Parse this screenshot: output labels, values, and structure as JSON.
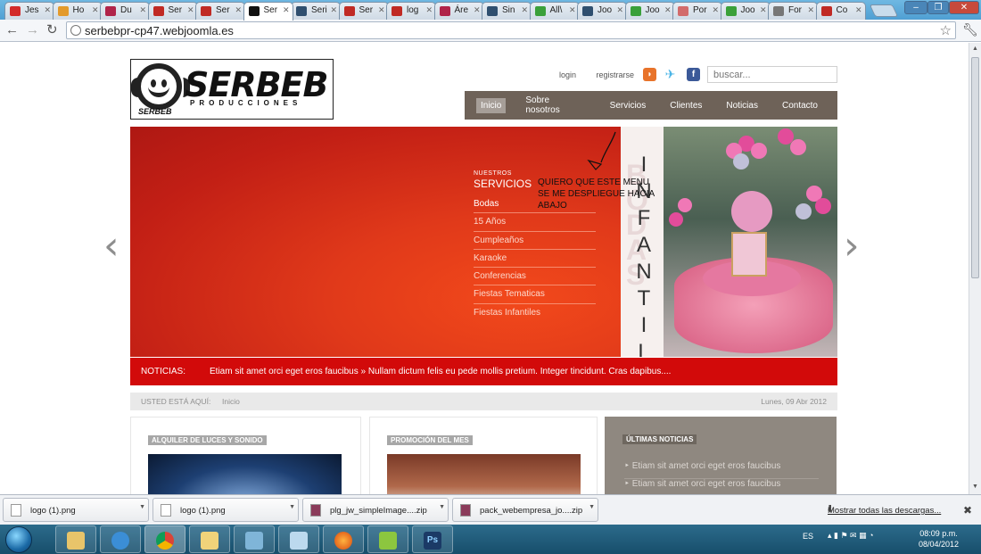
{
  "browser": {
    "tabs": [
      {
        "label": "Jes",
        "favicon": "youtube-icon",
        "color": "#d32b2b"
      },
      {
        "label": "Ho",
        "favicon": "hotmail-icon",
        "color": "#e39a2c"
      },
      {
        "label": "Du",
        "favicon": "forum-icon",
        "color": "#b0244a"
      },
      {
        "label": "Ser",
        "favicon": "site-icon",
        "color": "#c02a24"
      },
      {
        "label": "Ser",
        "favicon": "site-icon",
        "color": "#c02a24"
      },
      {
        "label": "Ser",
        "favicon": "joomla-icon",
        "color": "#111111"
      },
      {
        "label": "Seri",
        "favicon": "joomla-icon",
        "color": "#2f4f6f"
      },
      {
        "label": "Ser",
        "favicon": "site-icon",
        "color": "#c02a24"
      },
      {
        "label": "log",
        "favicon": "site-icon",
        "color": "#c02a24"
      },
      {
        "label": "Áre",
        "favicon": "forum-icon",
        "color": "#b0244a"
      },
      {
        "label": "Sin",
        "favicon": "joomla-icon",
        "color": "#2f4f6f"
      },
      {
        "label": "All\\",
        "favicon": "w-icon",
        "color": "#3aa03a"
      },
      {
        "label": "Joo",
        "favicon": "joomla-icon",
        "color": "#2f4f6f"
      },
      {
        "label": "Joo",
        "favicon": "w-icon",
        "color": "#3aa03a"
      },
      {
        "label": "Por",
        "favicon": "puzzle-icon",
        "color": "#d26b6b"
      },
      {
        "label": "Joo",
        "favicon": "w-icon",
        "color": "#3aa03a"
      },
      {
        "label": "For",
        "favicon": "globe-icon",
        "color": "#777777"
      },
      {
        "label": "Co",
        "favicon": "site-icon",
        "color": "#c02a24"
      }
    ],
    "active_tab_index": 5,
    "url": "serbebpr-cp47.webjoomla.es"
  },
  "site": {
    "logo": {
      "brand": "SERBEB",
      "sub": "PRODUCCIONES",
      "mini": "SERBEB"
    },
    "toplinks": {
      "login": "login",
      "register": "registrarse"
    },
    "search_placeholder": "buscar...",
    "nav": [
      "Inicio",
      "Sobre nosotros",
      "Servicios",
      "Clientes",
      "Noticias",
      "Contacto"
    ],
    "services": {
      "small": "NUESTROS",
      "title": "SERVICIOS",
      "items": [
        "Bodas",
        "15 Años",
        "Cumpleaños",
        "Karaoke",
        "Conferencias",
        "Fiestas Tematicas",
        "Fiestas Infantiles"
      ]
    },
    "slide_vertical_text": "INFANTILES",
    "annotation": "QUIERO QUE ESTE MENU SE ME DESPLIEGUE HACIA ABAJO",
    "ticker": {
      "label": "NOTICIAS:",
      "text": "Etiam sit amet orci eget eros faucibus » Nullam dictum felis eu pede mollis pretium. Integer tincidunt. Cras dapibus...."
    },
    "breadcrumb": {
      "here": "USTED ESTÁ AQUÍ:",
      "current": "Inicio",
      "date": "Lunes, 09 Abr 2012"
    },
    "boxes": {
      "lights": "ALQUILER DE LUCES Y SONIDO",
      "promo": "PROMOCIÓN DEL MES",
      "news_title": "ÚLTIMAS NOTICIAS",
      "news_items": [
        "Etiam sit amet orci eget eros faucibus",
        "Etiam sit amet orci eget eros faucibus"
      ]
    }
  },
  "downloads": {
    "items": [
      "logo (1).png",
      "logo (1).png",
      "plg_jw_simpleImage....zip",
      "pack_webempresa_jo....zip"
    ],
    "show_all": "Mostrar todas las descargas..."
  },
  "taskbar": {
    "lang": "ES",
    "time": "08:09 p.m.",
    "date": "08/04/2012"
  },
  "colors": {
    "nav_bg": "#6e6258",
    "ticker_bg": "#d20a0a",
    "slider_red": "#e0391a"
  }
}
